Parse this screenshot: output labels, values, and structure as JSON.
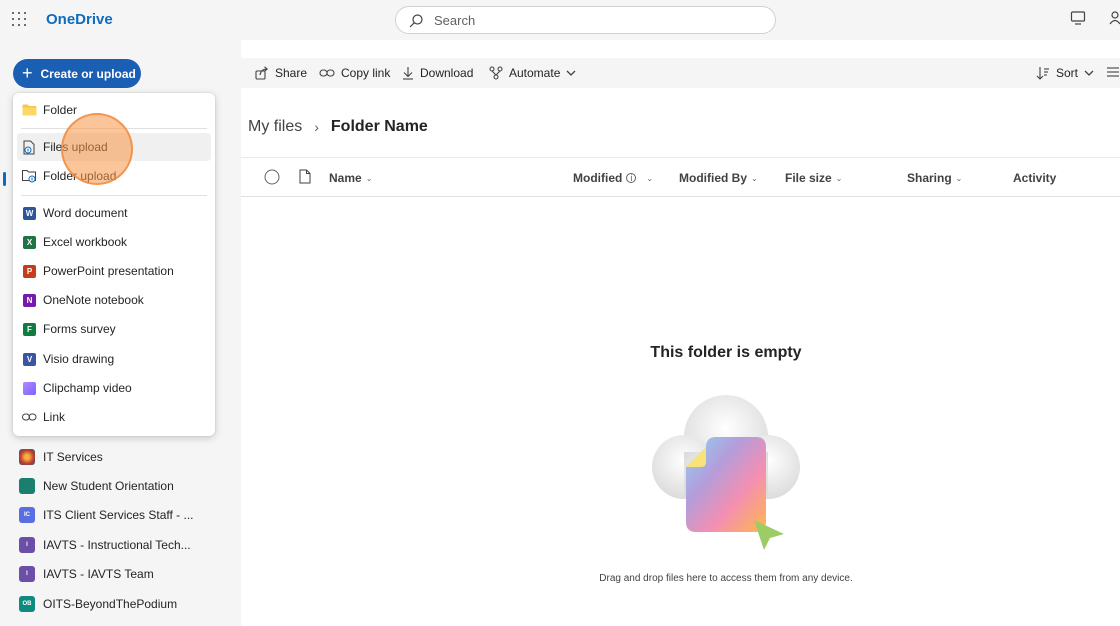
{
  "app": {
    "name": "OneDrive"
  },
  "search": {
    "placeholder": "Search"
  },
  "create_button": {
    "label": "Create or upload"
  },
  "toolbar": {
    "share": "Share",
    "copy_link": "Copy link",
    "download": "Download",
    "automate": "Automate",
    "sort": "Sort"
  },
  "menu": {
    "items": [
      {
        "label": "Folder",
        "icon": "folder-icon"
      },
      {
        "label": "Files upload",
        "icon": "file-upload-icon"
      },
      {
        "label": "Folder upload",
        "icon": "folder-upload-icon"
      },
      {
        "label": "Word document",
        "icon": "word-icon",
        "color": "#2b579a",
        "letter": "W"
      },
      {
        "label": "Excel workbook",
        "icon": "excel-icon",
        "color": "#217346",
        "letter": "X"
      },
      {
        "label": "PowerPoint presentation",
        "icon": "powerpoint-icon",
        "color": "#c43e1c",
        "letter": "P"
      },
      {
        "label": "OneNote notebook",
        "icon": "onenote-icon",
        "color": "#7719aa",
        "letter": "N"
      },
      {
        "label": "Forms survey",
        "icon": "forms-icon",
        "color": "#107c41",
        "letter": "F"
      },
      {
        "label": "Visio drawing",
        "icon": "visio-icon",
        "color": "#3955a3",
        "letter": "V"
      },
      {
        "label": "Clipchamp video",
        "icon": "clipchamp-icon",
        "color": "#7b61ff"
      },
      {
        "label": "Link",
        "icon": "link-icon"
      }
    ]
  },
  "sidebar": {
    "items": [
      {
        "label": "IT Services",
        "color": "#c0392b"
      },
      {
        "label": "New Student Orientation",
        "color": "#1a7f6e"
      },
      {
        "label": "ITS Client Services Staff - ...",
        "color": "#5b6ee1",
        "initials": "IC"
      },
      {
        "label": "IAVTS - Instructional Tech...",
        "color": "#6b4ea8",
        "initials": "I"
      },
      {
        "label": "IAVTS - IAVTS Team",
        "color": "#6b4ea8",
        "initials": "I"
      },
      {
        "label": "OITS-BeyondThePodium",
        "color": "#0e8a7e",
        "initials": "OB"
      }
    ]
  },
  "breadcrumb": {
    "root": "My files",
    "current": "Folder Name"
  },
  "columns": {
    "name": "Name",
    "modified": "Modified",
    "modified_by": "Modified By",
    "file_size": "File size",
    "sharing": "Sharing",
    "activity": "Activity"
  },
  "empty_state": {
    "title": "This folder is empty",
    "subtitle": "Drag and drop files here to access them from any device."
  }
}
